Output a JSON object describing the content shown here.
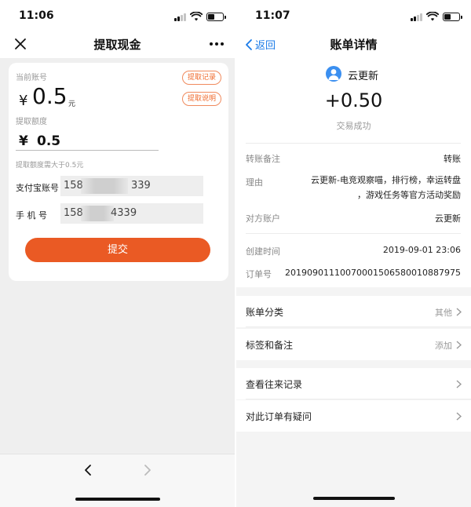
{
  "left_screen": {
    "status_time": "11:06",
    "nav": {
      "title": "提取现金"
    },
    "account": {
      "label": "当前账号",
      "currency": "¥",
      "amount": "0.5",
      "unit": "元"
    },
    "buttons": {
      "record": "提取记录",
      "explain": "提取说明",
      "submit": "提交"
    },
    "withdraw": {
      "label": "提取额度",
      "currency": "¥",
      "value": "0.5",
      "hint": "提取额度需大于0.5元"
    },
    "alipay": {
      "label": "支付宝账号",
      "visible_start": "158",
      "visible_end": "339"
    },
    "phone": {
      "label": "手 机 号",
      "visible_start": "158",
      "visible_end": "4339"
    }
  },
  "right_screen": {
    "status_time": "11:07",
    "nav": {
      "back_label": "返回",
      "title": "账单详情"
    },
    "header": {
      "payee": "云更新",
      "amount": "+0.50",
      "status": "交易成功"
    },
    "details": {
      "remark": {
        "label": "转账备注",
        "value": "转账"
      },
      "reason": {
        "label": "理由",
        "line1": "云更新-电竞观察喵，排行榜，幸运转盘",
        "line2": "，游戏任务等官方活动奖励"
      },
      "counterparty": {
        "label": "对方账户",
        "value": "云更新"
      },
      "created": {
        "label": "创建时间",
        "value": "2019-09-01 23:06"
      },
      "order": {
        "label": "订单号",
        "value": "2019090111007000150658001088797​5"
      }
    },
    "rows": {
      "category": {
        "label": "账单分类",
        "value": "其他"
      },
      "tags": {
        "label": "标签和备注",
        "value": "添加"
      },
      "history": {
        "label": "查看往来记录"
      },
      "question": {
        "label": "对此订单有疑问"
      }
    }
  }
}
